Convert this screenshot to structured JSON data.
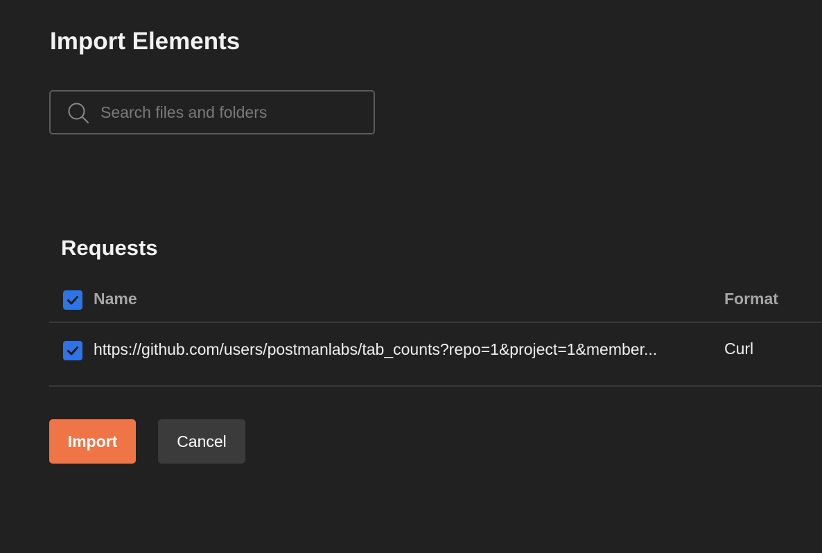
{
  "page": {
    "title": "Import Elements"
  },
  "search": {
    "placeholder": "Search files and folders",
    "value": ""
  },
  "requests": {
    "section_title": "Requests",
    "columns": {
      "name": "Name",
      "format": "Format"
    },
    "select_all_checked": true,
    "rows": [
      {
        "checked": true,
        "name": "https://github.com/users/postmanlabs/tab_counts?repo=1&project=1&member...",
        "format": "Curl"
      }
    ]
  },
  "actions": {
    "import_label": "Import",
    "cancel_label": "Cancel"
  },
  "colors": {
    "background": "#212121",
    "accent": "#ef7547",
    "checkbox": "#2f74e6",
    "secondary_button": "#3b3b3b"
  },
  "icons": {
    "search": "search-icon",
    "check": "checkmark-icon"
  }
}
